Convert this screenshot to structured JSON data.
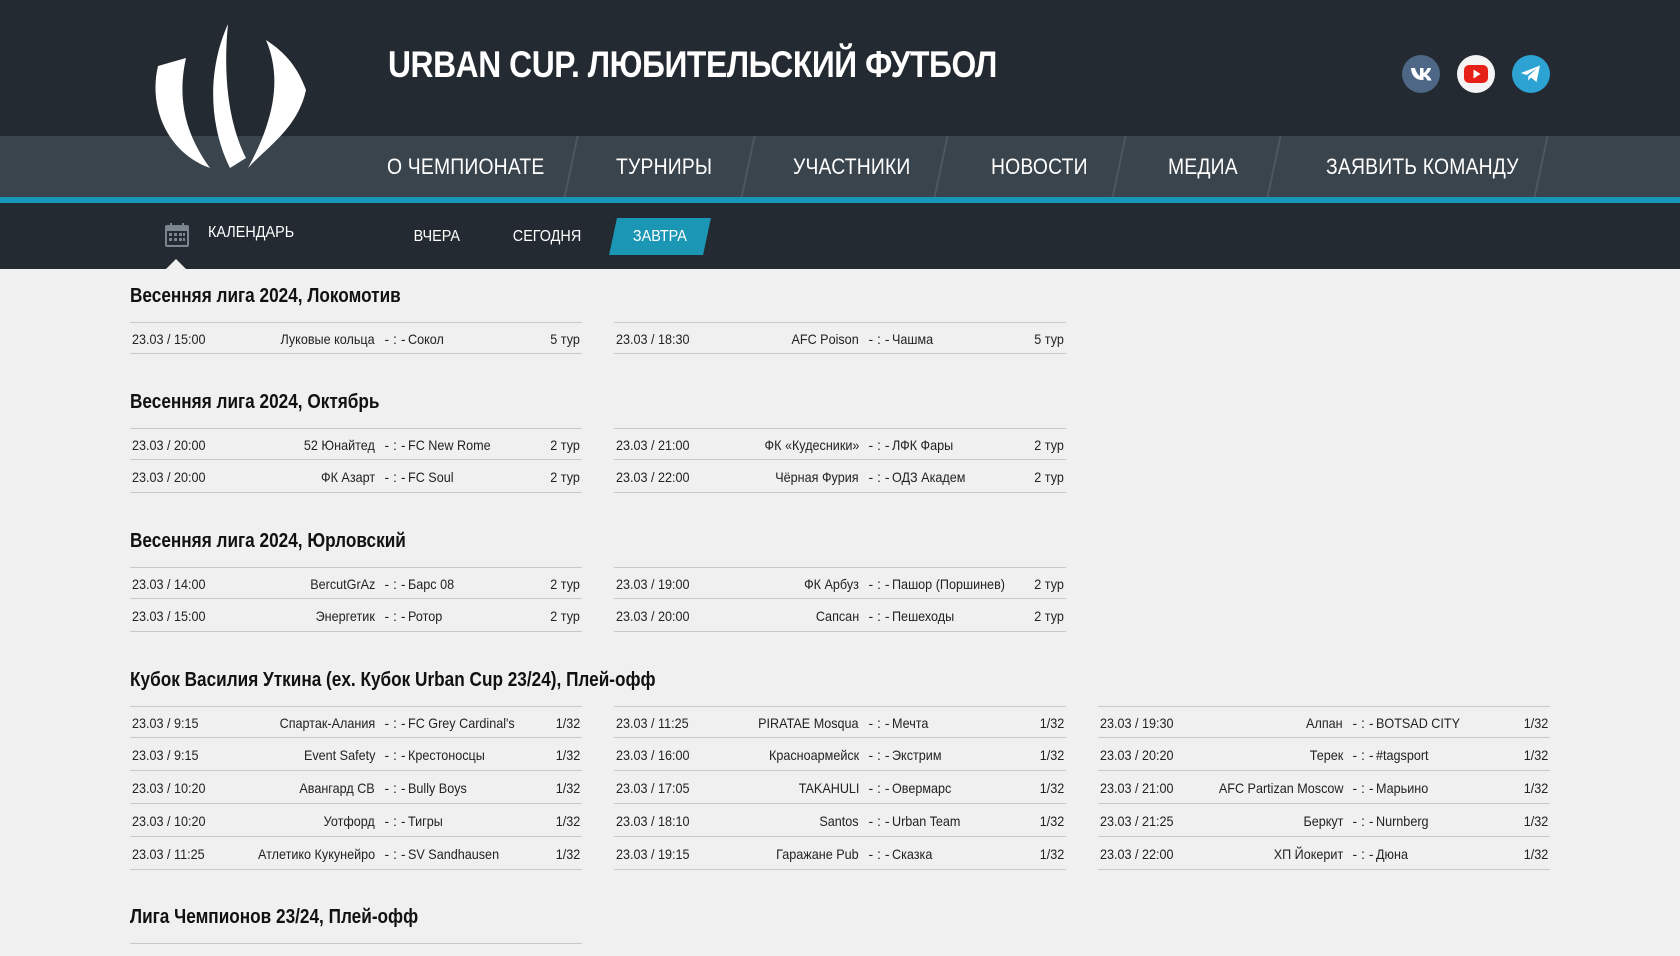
{
  "header": {
    "title": "URBAN CUP. ЛЮБИТЕЛЬСКИЙ ФУТБОЛ",
    "social": [
      {
        "name": "vk-icon",
        "label": "VK",
        "color": "#4e6786"
      },
      {
        "name": "youtube-icon",
        "label": "YouTube",
        "color": "#e62117"
      },
      {
        "name": "telegram-icon",
        "label": "Telegram",
        "color": "#2da3d4"
      }
    ]
  },
  "nav": {
    "items": [
      {
        "label": "О ЧЕМПИОНАТЕ"
      },
      {
        "label": "ТУРНИРЫ"
      },
      {
        "label": "УЧАСТНИКИ"
      },
      {
        "label": "НОВОСТИ"
      },
      {
        "label": "МЕДИА"
      },
      {
        "label": "ЗАЯВИТЬ КОМАНДУ"
      }
    ]
  },
  "subnav": {
    "calendar_label": "КАЛЕНДАРЬ",
    "tabs": [
      {
        "label": "ВЧЕРА",
        "active": false
      },
      {
        "label": "СЕГОДНЯ",
        "active": false
      },
      {
        "label": "ЗАВТРА",
        "active": true
      }
    ]
  },
  "colors": {
    "header_bg": "#232a31",
    "nav_bg": "#3a444c",
    "accent": "#1597b7",
    "page_bg": "#f0f0f0"
  },
  "sections": [
    {
      "title": "Весенняя лига 2024, Локомотив",
      "matches": [
        {
          "date": "23.03 / 15:00",
          "home": "Луковые кольца",
          "score": "- : -",
          "away": "Сокол",
          "round": "5 тур"
        },
        {
          "date": "23.03 / 18:30",
          "home": "AFC Poison",
          "score": "- : -",
          "away": "Чашма",
          "round": "5 тур"
        }
      ]
    },
    {
      "title": "Весенняя лига 2024, Октябрь",
      "matches": [
        {
          "date": "23.03 / 20:00",
          "home": "52 Юнайтед",
          "score": "- : -",
          "away": "FC New Rome",
          "round": "2 тур"
        },
        {
          "date": "23.03 / 20:00",
          "home": "ФК Азарт",
          "score": "- : -",
          "away": "FC Soul",
          "round": "2 тур"
        },
        {
          "date": "23.03 / 21:00",
          "home": "ФК «Кудесники»",
          "score": "- : -",
          "away": "ЛФК Фары",
          "round": "2 тур"
        },
        {
          "date": "23.03 / 22:00",
          "home": "Чёрная Фурия",
          "score": "- : -",
          "away": "ОДЗ Академ",
          "round": "2 тур"
        }
      ]
    },
    {
      "title": "Весенняя лига 2024, Юрловский",
      "matches": [
        {
          "date": "23.03 / 14:00",
          "home": "BercutGrAz",
          "score": "- : -",
          "away": "Барс 08",
          "round": "2 тур"
        },
        {
          "date": "23.03 / 15:00",
          "home": "Энергетик",
          "score": "- : -",
          "away": "Ротор",
          "round": "2 тур"
        },
        {
          "date": "23.03 / 19:00",
          "home": "ФК Арбуз",
          "score": "- : -",
          "away": "Пашор (Поршинев)",
          "round": "2 тур"
        },
        {
          "date": "23.03 / 20:00",
          "home": "Сапсан",
          "score": "- : -",
          "away": "Пешеходы",
          "round": "2 тур"
        }
      ]
    },
    {
      "title": "Кубок Василия Уткина (ex. Кубок Urban Cup 23/24), Плей-офф",
      "matches": [
        {
          "date": "23.03 / 9:15",
          "home": "Спартак-Алания",
          "score": "- : -",
          "away": "FC Grey Cardinal's",
          "round": "1/32"
        },
        {
          "date": "23.03 / 9:15",
          "home": "Event Safety",
          "score": "- : -",
          "away": "Крестоносцы",
          "round": "1/32"
        },
        {
          "date": "23.03 / 10:20",
          "home": "Авангард СВ",
          "score": "- : -",
          "away": "Bully Boys",
          "round": "1/32"
        },
        {
          "date": "23.03 / 10:20",
          "home": "Уотфорд",
          "score": "- : -",
          "away": "Тигры",
          "round": "1/32"
        },
        {
          "date": "23.03 / 11:25",
          "home": "Атлетико Кукунейро",
          "score": "- : -",
          "away": "SV Sandhausen",
          "round": "1/32"
        },
        {
          "date": "23.03 / 11:25",
          "home": "PIRATAE Mosqua",
          "score": "- : -",
          "away": "Мечта",
          "round": "1/32"
        },
        {
          "date": "23.03 / 16:00",
          "home": "Красноармейск",
          "score": "- : -",
          "away": "Экстрим",
          "round": "1/32"
        },
        {
          "date": "23.03 / 17:05",
          "home": "TAKAHULI",
          "score": "- : -",
          "away": "Овермарс",
          "round": "1/32"
        },
        {
          "date": "23.03 / 18:10",
          "home": "Santos",
          "score": "- : -",
          "away": "Urban Team",
          "round": "1/32"
        },
        {
          "date": "23.03 / 19:15",
          "home": "Гаражане Pub",
          "score": "- : -",
          "away": "Сказка",
          "round": "1/32"
        },
        {
          "date": "23.03 / 19:30",
          "home": "Алпан",
          "score": "- : -",
          "away": "BOTSAD CITY",
          "round": "1/32"
        },
        {
          "date": "23.03 / 20:20",
          "home": "Терек",
          "score": "- : -",
          "away": "#tagsport",
          "round": "1/32"
        },
        {
          "date": "23.03 / 21:00",
          "home": "AFC Partizan Moscow",
          "score": "- : -",
          "away": "Марьино",
          "round": "1/32"
        },
        {
          "date": "23.03 / 21:25",
          "home": "Беркут",
          "score": "- : -",
          "away": "Nurnberg",
          "round": "1/32"
        },
        {
          "date": "23.03 / 22:00",
          "home": "ХП Йокерит",
          "score": "- : -",
          "away": "Дюна",
          "round": "1/32"
        }
      ]
    },
    {
      "title": "Лига Чемпионов 23/24, Плей-офф",
      "matches": []
    }
  ]
}
